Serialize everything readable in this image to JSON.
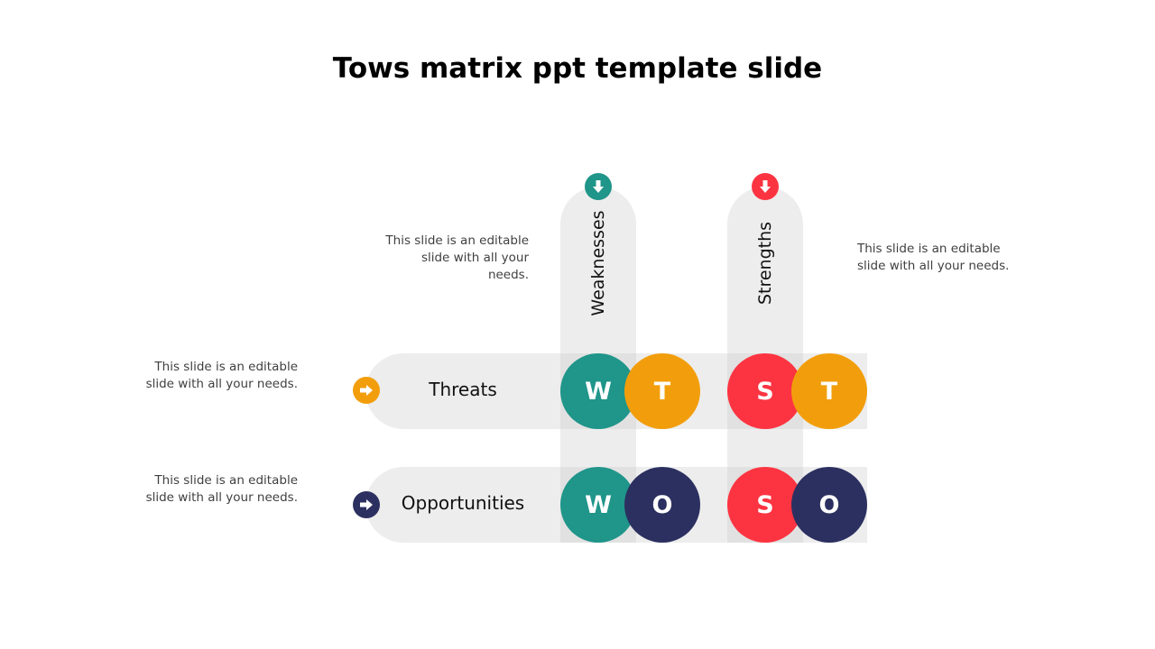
{
  "title": "Tows matrix ppt template slide",
  "colors": {
    "teal": "#20958a",
    "red": "#fc3441",
    "orange": "#f29e0c",
    "navy": "#2c3060",
    "bar": "#ededed",
    "overlap": "#e1e1e1"
  },
  "columns": [
    {
      "label": "Weaknesses",
      "letter": "W",
      "icon": "arrow-down-icon",
      "color": "#20958a"
    },
    {
      "label": "Strengths",
      "letter": "S",
      "icon": "arrow-down-icon",
      "color": "#fc3441"
    }
  ],
  "rows": [
    {
      "label": "Threats",
      "letter": "T",
      "icon": "arrow-right-icon",
      "color": "#f29e0c"
    },
    {
      "label": "Opportunities",
      "letter": "O",
      "icon": "arrow-right-icon",
      "color": "#2c3060"
    }
  ],
  "cells": [
    [
      "W",
      "T",
      "S",
      "T"
    ],
    [
      "W",
      "O",
      "S",
      "O"
    ]
  ],
  "descriptions": {
    "weaknesses": "This slide is an editable slide with all your needs.",
    "strengths": "This slide is an editable slide with all your needs.",
    "threats": "This slide is an editable slide with all your needs.",
    "opportunities": "This slide is an editable slide with all your needs."
  }
}
